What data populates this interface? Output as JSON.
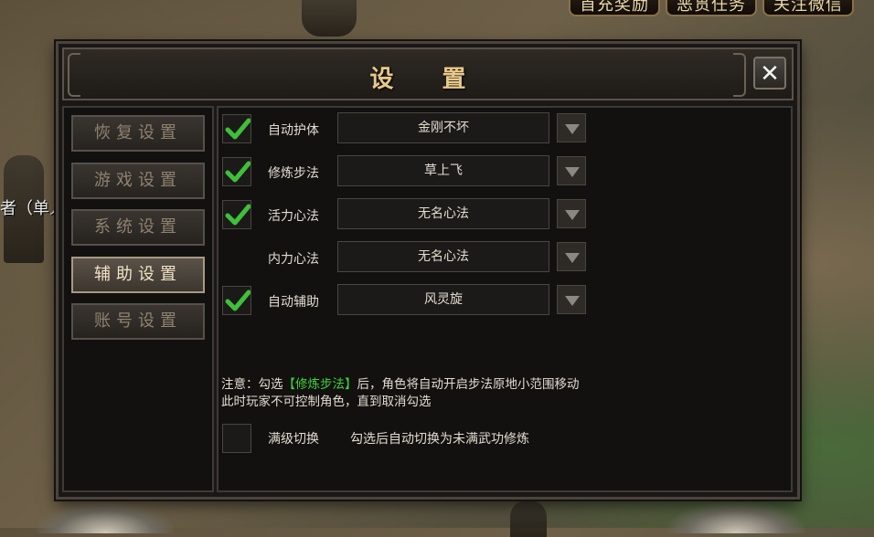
{
  "top_tabs": [
    "首充奖励",
    "恶贯任务",
    "关注微信"
  ],
  "npc_name": "者（单人",
  "dialog": {
    "title": "设 置",
    "close_label": "✕",
    "sidebar": [
      {
        "label": "恢复设置",
        "active": false
      },
      {
        "label": "游戏设置",
        "active": false
      },
      {
        "label": "系统设置",
        "active": false
      },
      {
        "label": "辅助设置",
        "active": true
      },
      {
        "label": "账号设置",
        "active": false
      }
    ],
    "options": [
      {
        "label": "自动护体",
        "checked": true,
        "has_checkbox": true,
        "value": "金刚不坏"
      },
      {
        "label": "修炼步法",
        "checked": true,
        "has_checkbox": true,
        "value": "草上飞"
      },
      {
        "label": "活力心法",
        "checked": true,
        "has_checkbox": true,
        "value": "无名心法"
      },
      {
        "label": "内力心法",
        "checked": false,
        "has_checkbox": false,
        "value": "无名心法"
      },
      {
        "label": "自动辅助",
        "checked": true,
        "has_checkbox": true,
        "value": "风灵旋"
      }
    ],
    "note": {
      "prefix": "注意：勾选",
      "highlight": "【修炼步法】",
      "suffix": "后，角色将自动开启步法原地小范围移动",
      "line2": "此时玩家不可控制角色，直到取消勾选"
    },
    "extra_option": {
      "label": "满级切换",
      "checked": false,
      "description": "勾选后自动切换为未满武功修炼"
    }
  },
  "colors": {
    "title": "#e8c98a",
    "highlight": "#3fd13a",
    "check": "#3fbf3a"
  }
}
